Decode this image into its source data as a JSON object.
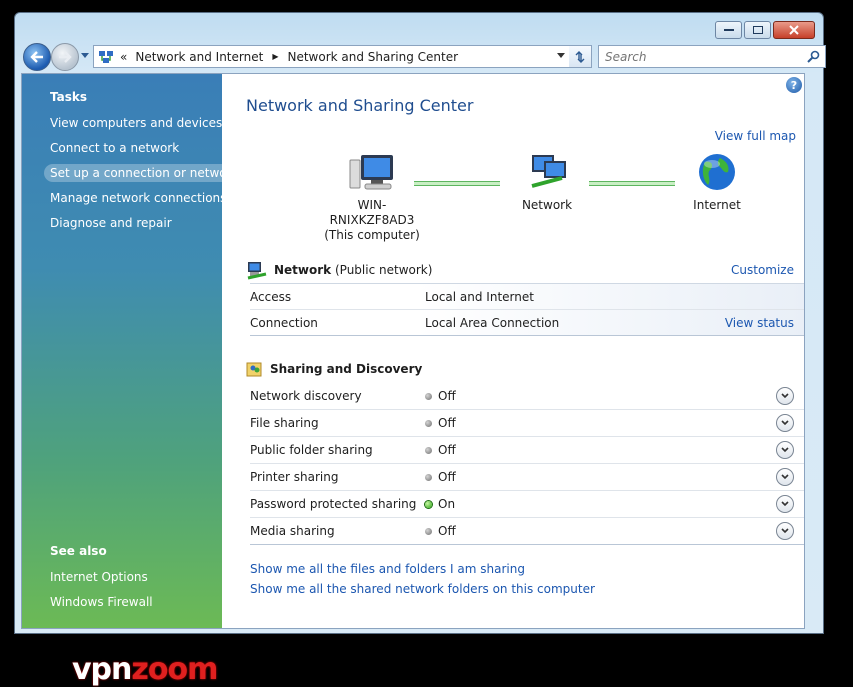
{
  "address": {
    "crumb_prefix": "«",
    "crumb1": "Network and Internet",
    "separator": "▶",
    "crumb2": "Network and Sharing Center"
  },
  "search": {
    "placeholder": "Search"
  },
  "sidebar": {
    "tasks_heading": "Tasks",
    "tasks": [
      {
        "label": "View computers and devices"
      },
      {
        "label": "Connect to a network"
      },
      {
        "label": "Set up a connection or network"
      },
      {
        "label": "Manage network connections"
      },
      {
        "label": "Diagnose and repair"
      }
    ],
    "see_also_heading": "See also",
    "see_also": [
      {
        "label": "Internet Options"
      },
      {
        "label": "Windows Firewall"
      }
    ]
  },
  "main": {
    "title": "Network and Sharing Center",
    "view_full_map": "View full map",
    "map": {
      "computer_name": "WIN-RNIXKZF8AD3",
      "computer_sub": "(This computer)",
      "network_label": "Network",
      "internet_label": "Internet"
    },
    "network_section": {
      "name": "Network",
      "type": "(Public network)",
      "customize": "Customize",
      "rows": [
        {
          "label": "Access",
          "value": "Local and Internet"
        },
        {
          "label": "Connection",
          "value": "Local Area Connection",
          "link": "View status"
        }
      ]
    },
    "sharing_section": {
      "heading": "Sharing and Discovery",
      "rows": [
        {
          "label": "Network discovery",
          "state": "Off"
        },
        {
          "label": "File sharing",
          "state": "Off"
        },
        {
          "label": "Public folder sharing",
          "state": "Off"
        },
        {
          "label": "Printer sharing",
          "state": "Off"
        },
        {
          "label": "Password protected sharing",
          "state": "On"
        },
        {
          "label": "Media sharing",
          "state": "Off"
        }
      ]
    },
    "bottom_links": [
      {
        "label": "Show me all the files and folders I am sharing"
      },
      {
        "label": "Show me all the shared network folders on this computer"
      }
    ]
  },
  "watermark": {
    "part1": "vpn",
    "part2": "zoom"
  },
  "colors": {
    "accent": "#1c57b0",
    "title": "#1f4d8f",
    "status_on": "#25a10f",
    "status_off": "#6e6e6e"
  }
}
